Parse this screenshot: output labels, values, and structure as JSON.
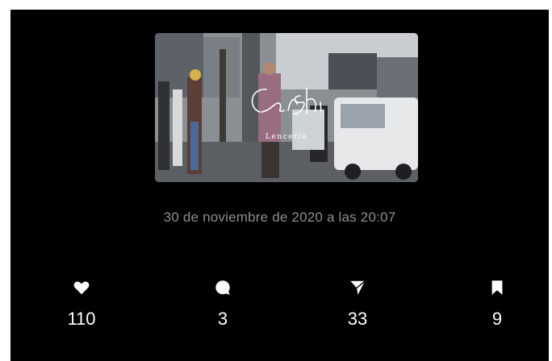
{
  "post": {
    "image": {
      "logo_text": "Cora She",
      "logo_subtext": "Lencería"
    },
    "timestamp": "30 de noviembre de 2020 a las 20:07"
  },
  "stats": {
    "likes": {
      "icon": "heart-icon",
      "count": "110"
    },
    "comments": {
      "icon": "comment-bubble-icon",
      "count": "3"
    },
    "shares": {
      "icon": "send-arrow-icon",
      "count": "33"
    },
    "saves": {
      "icon": "bookmark-icon",
      "count": "9"
    }
  },
  "colors": {
    "background": "#000000",
    "text_primary": "#ffffff",
    "text_secondary": "#8e8e93"
  }
}
